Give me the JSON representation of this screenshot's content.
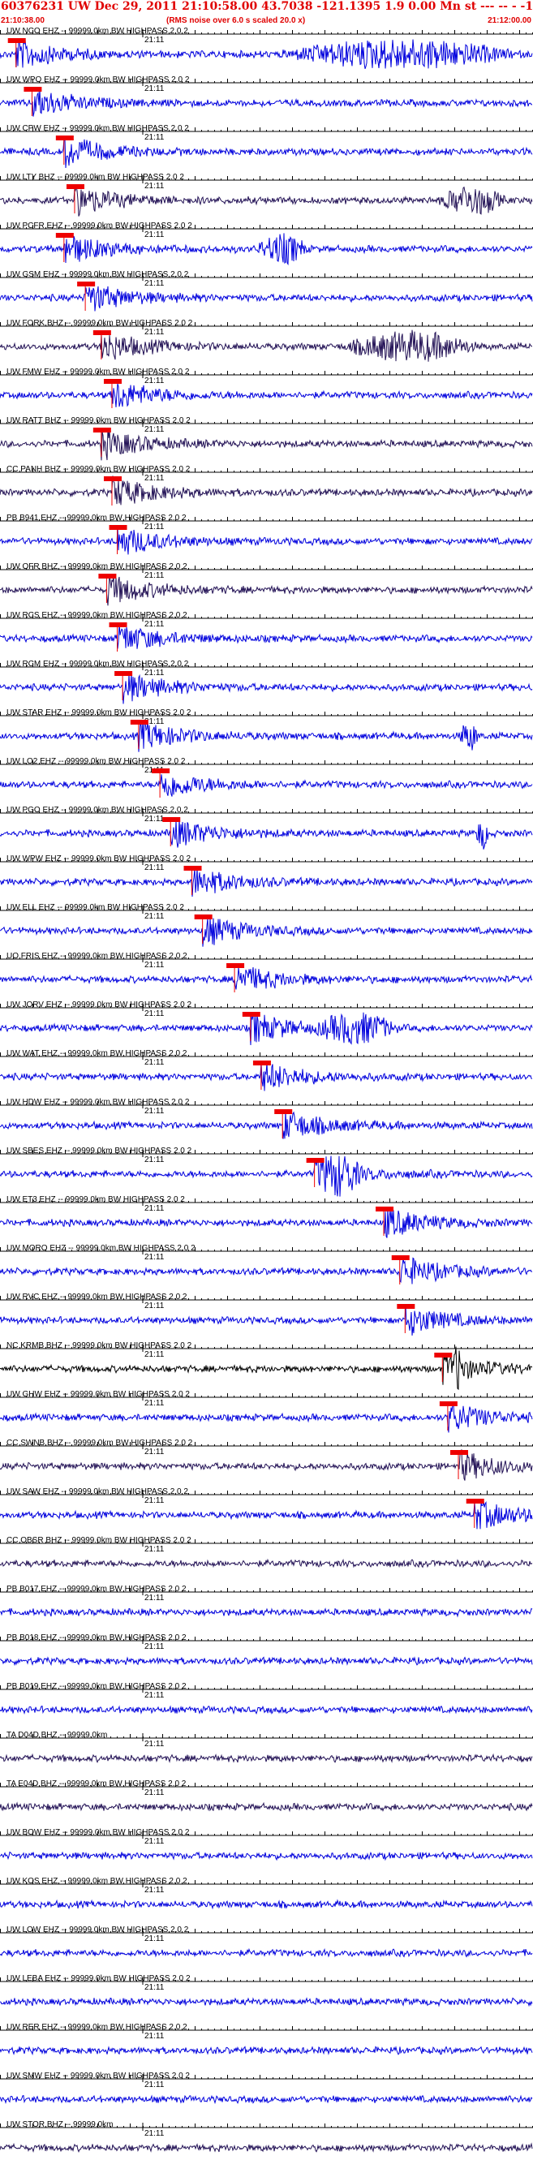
{
  "title": "60376231 UW Dec 29, 2011 21:10:58.00   43.7038 -121.1395  1.9 0.00 Mn st --- -- - -1",
  "time_start": "21:10:38.00",
  "time_end": "21:12:00.00",
  "rms_note": "(RMS noise over 6.0 s scaled 20.0 x)",
  "minute_label": "21:11",
  "colors": {
    "trace": "#0000dd",
    "trace_dark": "#221155",
    "trace_black": "#000000",
    "pick": "#ee0000",
    "axis": "#000000",
    "title": "#e00000"
  },
  "chart_data": {
    "type": "line",
    "x_range": [
      "21:10:38.00",
      "21:12:00.00"
    ],
    "minute_tick": "21:11",
    "stations": [
      {
        "label": "UW NCO EHZ -- 99999.0km BW  HIGHPASS  2.0  2",
        "pick": 0.03,
        "burst": [
          0.52,
          0.98
        ],
        "style": "blue"
      },
      {
        "label": "UW WPO EHZ -- 99999.0km BW  HIGHPASS  2.0  2",
        "pick": 0.06,
        "burst": null,
        "style": "blue"
      },
      {
        "label": "UW CPW EHZ -- 99999.0km BW  HIGHPASS  2.0  2",
        "pick": 0.12,
        "burst": null,
        "style": "blue"
      },
      {
        "label": "UW LTY BHZ -- 99999.0km BW  HIGHPASS  2.0  2",
        "pick": 0.14,
        "burst": [
          0.82,
          0.95
        ],
        "style": "dark"
      },
      {
        "label": "UW PCFR EHZ -- 99999.0km BW  HIGHPASS  2.0  2",
        "pick": 0.12,
        "burst": [
          0.48,
          0.58
        ],
        "style": "blue"
      },
      {
        "label": "UW GSM EHZ -- 99999.0km BW  HIGHPASS  2.0  2",
        "pick": 0.16,
        "burst": null,
        "style": "blue"
      },
      {
        "label": "UW FORK BHZ -- 99999.0km BW  HIGHPASS  2.0  2",
        "pick": 0.19,
        "burst": [
          0.64,
          0.9
        ],
        "style": "dark"
      },
      {
        "label": "UW FMW EHZ -- 99999.0km BW  HIGHPASS  2.0  2",
        "pick": 0.21,
        "burst": null,
        "style": "blue"
      },
      {
        "label": "UW RATT BHZ -- 99999.0km BW  HIGHPASS  2.0  2",
        "pick": 0.19,
        "burst": null,
        "style": "dark"
      },
      {
        "label": "CC PANH BHZ -- 99999.0km BW  HIGHPASS  2.0  2",
        "pick": 0.21,
        "burst": null,
        "style": "dark"
      },
      {
        "label": "PB B941 EHZ -- 99999.0km BW  HIGHPASS  2.0  2",
        "pick": 0.22,
        "burst": null,
        "style": "blue"
      },
      {
        "label": "UW OFR BHZ -- 99999.0km BW  HIGHPASS  2.0  2",
        "pick": 0.2,
        "burst": null,
        "style": "dark"
      },
      {
        "label": "UW RCS EHZ -- 99999.0km BW  HIGHPASS  2.0  2",
        "pick": 0.22,
        "burst": null,
        "style": "blue"
      },
      {
        "label": "UW RCM EHZ -- 99999.0km BW  HIGHPASS  2.0  2",
        "pick": 0.23,
        "burst": null,
        "style": "blue"
      },
      {
        "label": "UW STAR EHZ -- 99999.0km BW  HIGHPASS  2.0  2",
        "pick": 0.26,
        "burst": [
          0.86,
          0.9
        ],
        "style": "blue"
      },
      {
        "label": "UW LO2 EHZ -- 99999.0km BW  HIGHPASS  2.0  2",
        "pick": 0.3,
        "burst": null,
        "style": "blue"
      },
      {
        "label": "UW PGO EHZ -- 99999.0km BW  HIGHPASS  2.0  2",
        "pick": 0.32,
        "burst": [
          0.89,
          0.92
        ],
        "style": "blue"
      },
      {
        "label": "UW WPW EHZ -- 99999.0km BW  HIGHPASS  2.0  2",
        "pick": 0.36,
        "burst": null,
        "style": "blue"
      },
      {
        "label": "UW ELL EHZ -- 99999.0km BW  HIGHPASS  2.0  2",
        "pick": 0.38,
        "burst": null,
        "style": "blue"
      },
      {
        "label": "UO FRIS EHZ -- 99999.0km BW  HIGHPASS  2.0  2",
        "pick": 0.44,
        "burst": null,
        "style": "blue"
      },
      {
        "label": "UW JORV EHZ -- 99999.0km BW  HIGHPASS  2.0  2",
        "pick": 0.47,
        "burst": [
          0.59,
          0.75
        ],
        "style": "blue"
      },
      {
        "label": "UW WAT EHZ -- 99999.0km BW  HIGHPASS  2.0  2",
        "pick": 0.49,
        "burst": null,
        "style": "blue"
      },
      {
        "label": "UW HDW EHZ -- 99999.0km BW  HIGHPASS  2.0  2",
        "pick": 0.53,
        "burst": null,
        "style": "blue"
      },
      {
        "label": "UW SBES EHZ -- 99999.0km BW  HIGHPASS  2.0  2",
        "pick": 0.59,
        "burst": [
          0.6,
          0.68
        ],
        "style": "blue"
      },
      {
        "label": "UW ET3 EHZ -- 99999.0km BW  HIGHPASS  2.0  2",
        "pick": 0.72,
        "burst": null,
        "style": "blue"
      },
      {
        "label": "UW MORO EHZ -- 99999.0km BW  HIGHPASS  2.0  2",
        "pick": 0.75,
        "burst": null,
        "style": "blue"
      },
      {
        "label": "UW RVC EHZ -- 99999.0km BW  HIGHPASS  2.0  2",
        "pick": 0.76,
        "burst": null,
        "style": "blue"
      },
      {
        "label": "NC KRMB BHZ -- 99999.0km BW  HIGHPASS  2.0  2",
        "pick": 0.83,
        "burst": [
          0.85,
          0.87
        ],
        "style": "black"
      },
      {
        "label": "UW GHW EHZ -- 99999.0km BW  HIGHPASS  2.0  2",
        "pick": 0.84,
        "burst": null,
        "style": "blue"
      },
      {
        "label": "CC SWNB BHZ -- 99999.0km BW  HIGHPASS  2.0  2",
        "pick": 0.86,
        "burst": null,
        "style": "dark"
      },
      {
        "label": "UW SAW EHZ -- 99999.0km BW  HIGHPASS  2.0  2",
        "pick": 0.89,
        "burst": null,
        "style": "blue"
      },
      {
        "label": "CC OBSR BHZ -- 99999.0km BW  HIGHPASS  2.0  2",
        "pick": null,
        "burst": null,
        "style": "dark"
      },
      {
        "label": "PB B017 EHZ -- 99999.0km BW  HIGHPASS  2.0  2",
        "pick": null,
        "burst": null,
        "style": "blue"
      },
      {
        "label": "PB B018 EHZ -- 99999.0km BW  HIGHPASS  2.0  2",
        "pick": null,
        "burst": null,
        "style": "blue"
      },
      {
        "label": "PB B019 EHZ -- 99999.0km BW  HIGHPASS  2.0  2",
        "pick": null,
        "burst": null,
        "style": "blue"
      },
      {
        "label": "TA D04D BHZ -- 99999.0km",
        "pick": null,
        "burst": null,
        "style": "dark"
      },
      {
        "label": "TA E04D BHZ -- 99999.0km BW  HIGHPASS  2.0  2",
        "pick": null,
        "burst": null,
        "style": "dark"
      },
      {
        "label": "UW BOW EHZ -- 99999.0km BW  HIGHPASS  2.0  2",
        "pick": null,
        "burst": null,
        "style": "blue"
      },
      {
        "label": "UW KOS EHZ -- 99999.0km BW  HIGHPASS  2.0  2",
        "pick": null,
        "burst": null,
        "style": "blue"
      },
      {
        "label": "UW LOW EHZ -- 99999.0km BW  HIGHPASS  2.0  2",
        "pick": null,
        "burst": null,
        "style": "blue"
      },
      {
        "label": "UW LEBA EHZ -- 99999.0km BW  HIGHPASS  2.0  2",
        "pick": null,
        "burst": null,
        "style": "blue"
      },
      {
        "label": "UW RER EHZ -- 99999.0km BW  HIGHPASS  2.0  2",
        "pick": null,
        "burst": null,
        "style": "blue"
      },
      {
        "label": "UW SMW EHZ -- 99999.0km BW  HIGHPASS  2.0  2",
        "pick": null,
        "burst": null,
        "style": "blue"
      },
      {
        "label": "UW STOR BHZ -- 99999.0km",
        "pick": null,
        "burst": null,
        "style": "dark"
      }
    ]
  }
}
